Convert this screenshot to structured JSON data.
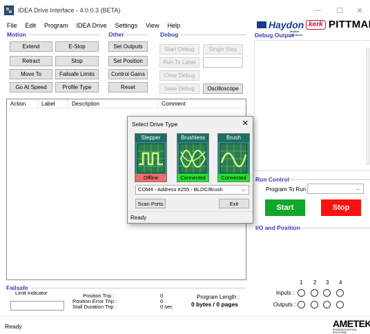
{
  "window": {
    "title": "IDEA Drive Interface - 4.0.0.3 (BETA)",
    "minimize": "—",
    "maximize": "☐",
    "close": "✕"
  },
  "menu": [
    "File",
    "Edit",
    "Program",
    "IDEA Drive",
    "Settings",
    "View",
    "Help"
  ],
  "logos": {
    "haydon": "Haydon",
    "haydon_sub": "Motion Solutions",
    "kerk": "kerk",
    "pittman": "PITTMAN",
    "ametek": "AMETEK",
    "ametek_sub": "ADVANCED MOTION SOLUTIONS"
  },
  "motion": {
    "title": "Motion",
    "buttons": [
      "Extend",
      "E-Stop",
      "Retract",
      "Stop",
      "Move To",
      "Failsafe Limits",
      "Go At Speed",
      "Profile Type"
    ]
  },
  "other": {
    "title": "Other",
    "buttons": [
      "Set Outputs",
      "Set Position",
      "Control Gains",
      "Reset"
    ]
  },
  "debug": {
    "title": "Debug",
    "buttons": [
      "Start Debug",
      "Single Step",
      "Run To Label",
      "Clear Debug",
      "Save Debug",
      "Oscilloscope"
    ]
  },
  "table": {
    "columns": [
      "Action",
      "Label",
      "Description",
      "Comment"
    ]
  },
  "debug_output": {
    "title": "Debug Output"
  },
  "run_control": {
    "title": "Run Control",
    "program_label": "Program To Run :",
    "program_value": "",
    "start": "Start",
    "stop": "Stop",
    "colors": {
      "start": "#10a82a",
      "stop": "#ff1010"
    }
  },
  "io": {
    "title": "I/O and Position",
    "numbers": [
      "1",
      "2",
      "3",
      "4"
    ],
    "inputs_label": "Inputs :",
    "outputs_label": "Outputs :"
  },
  "failsafe": {
    "title": "Failsafe",
    "limit_indicator": "Limit Indicator",
    "position_trip_label": "Position Trip :",
    "position_error_trip_label": "Position Error Trip :",
    "stall_duration_trip_label": "Stall Duration Trip :",
    "position_trip": "0",
    "position_error_trip": "0",
    "stall_duration_trip": "0  sec",
    "program_length_label": "Program Length :",
    "program_length": "0 bytes / 0 pages"
  },
  "status": "Ready",
  "dialog": {
    "title": "Select Drive Type",
    "close": "✕",
    "drives": [
      {
        "name": "Stepper",
        "status": "Offline",
        "status_color": "#f26a6a"
      },
      {
        "name": "Brushless",
        "status": "Connected",
        "status_color": "#22e22a"
      },
      {
        "name": "Brush",
        "status": "Connected",
        "status_color": "#22e22a"
      }
    ],
    "port_value": "COM4 - Address #255 - BLDC/Brush",
    "scan_ports": "Scan Ports",
    "exit": "Exit",
    "status": "Ready"
  }
}
